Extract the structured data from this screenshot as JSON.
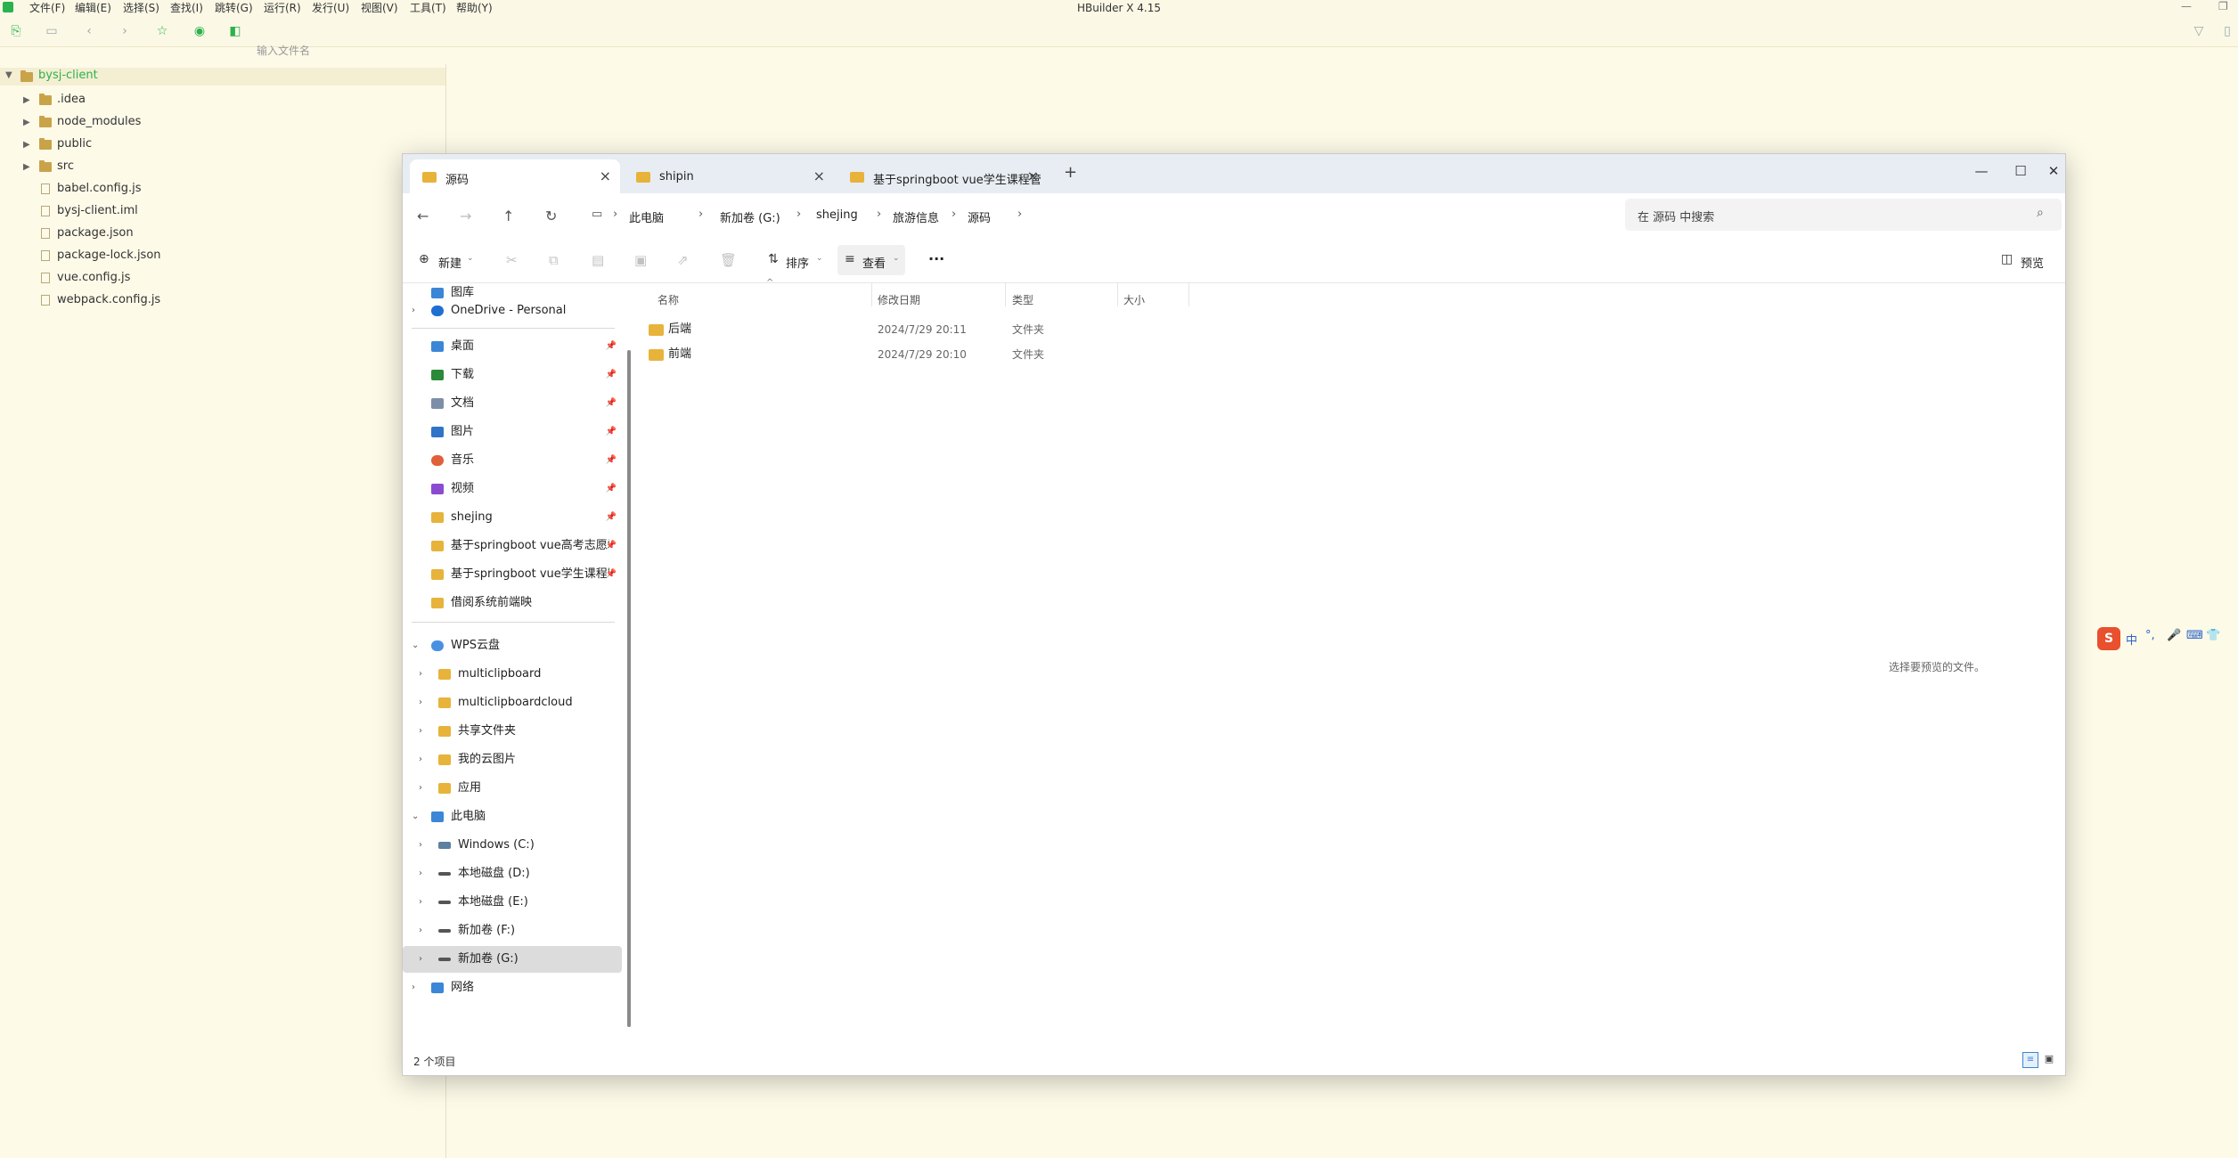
{
  "hbuilder": {
    "title": "HBuilder X 4.15",
    "menu": [
      "文件(F)",
      "编辑(E)",
      "选择(S)",
      "查找(I)",
      "跳转(G)",
      "运行(R)",
      "发行(U)",
      "视图(V)",
      "工具(T)",
      "帮助(Y)"
    ],
    "filename_placeholder": "输入文件名",
    "project": {
      "name": "bysj-client",
      "folders": [
        ".idea",
        "node_modules",
        "public",
        "src"
      ],
      "files": [
        "babel.config.js",
        "bysj-client.iml",
        "package.json",
        "package-lock.json",
        "vue.config.js",
        "webpack.config.js"
      ]
    }
  },
  "explorer": {
    "tabs": [
      {
        "label": "源码",
        "active": true
      },
      {
        "label": "shipin",
        "active": false
      },
      {
        "label": "基于springboot vue学生课程管",
        "active": false
      }
    ],
    "breadcrumbs": [
      "此电脑",
      "新加卷 (G:)",
      "shejing",
      "旅游信息",
      "源码"
    ],
    "search_placeholder": "在 源码 中搜索",
    "commands": {
      "new": "新建",
      "sort": "排序",
      "view": "查看",
      "more": "···",
      "preview": "预览"
    },
    "nav": {
      "gallery": "图库",
      "onedrive": "OneDrive - Personal",
      "quick_access": [
        {
          "label": "桌面",
          "icon": "desktop-icon",
          "color": "#3b86d6"
        },
        {
          "label": "下载",
          "icon": "download-icon",
          "color": "#2a8a3a"
        },
        {
          "label": "文档",
          "icon": "document-icon",
          "color": "#7d8ea8"
        },
        {
          "label": "图片",
          "icon": "picture-icon",
          "color": "#2f74c9"
        },
        {
          "label": "音乐",
          "icon": "music-icon",
          "color": "#e0603a"
        },
        {
          "label": "视频",
          "icon": "video-icon",
          "color": "#8a4bd0"
        },
        {
          "label": "shejing",
          "icon": "folder-icon",
          "color": "#e7b33a"
        },
        {
          "label": "基于springboot vue高考志愿填",
          "icon": "folder-icon",
          "color": "#e7b33a"
        },
        {
          "label": "基于springboot vue学生课程管",
          "icon": "folder-icon",
          "color": "#e7b33a"
        },
        {
          "label": "借阅系统前端映",
          "icon": "folder-icon",
          "color": "#e7b33a"
        }
      ],
      "wps_cloud": "WPS云盘",
      "wps_items": [
        "multiclipboard",
        "multiclipboardcloud",
        "共享文件夹",
        "我的云图片",
        "应用"
      ],
      "this_pc": "此电脑",
      "drives": [
        "Windows (C:)",
        "本地磁盘 (D:)",
        "本地磁盘 (E:)",
        "新加卷 (F:)",
        "新加卷 (G:)"
      ],
      "network": "网络"
    },
    "columns": [
      "名称",
      "修改日期",
      "类型",
      "大小"
    ],
    "files": [
      {
        "name": "后端",
        "date": "2024/7/29 20:11",
        "type": "文件夹",
        "size": ""
      },
      {
        "name": "前端",
        "date": "2024/7/29 20:10",
        "type": "文件夹",
        "size": ""
      }
    ],
    "preview_hint": "选择要预览的文件。",
    "status": "2 个项目"
  },
  "ime": {
    "label": "中"
  }
}
